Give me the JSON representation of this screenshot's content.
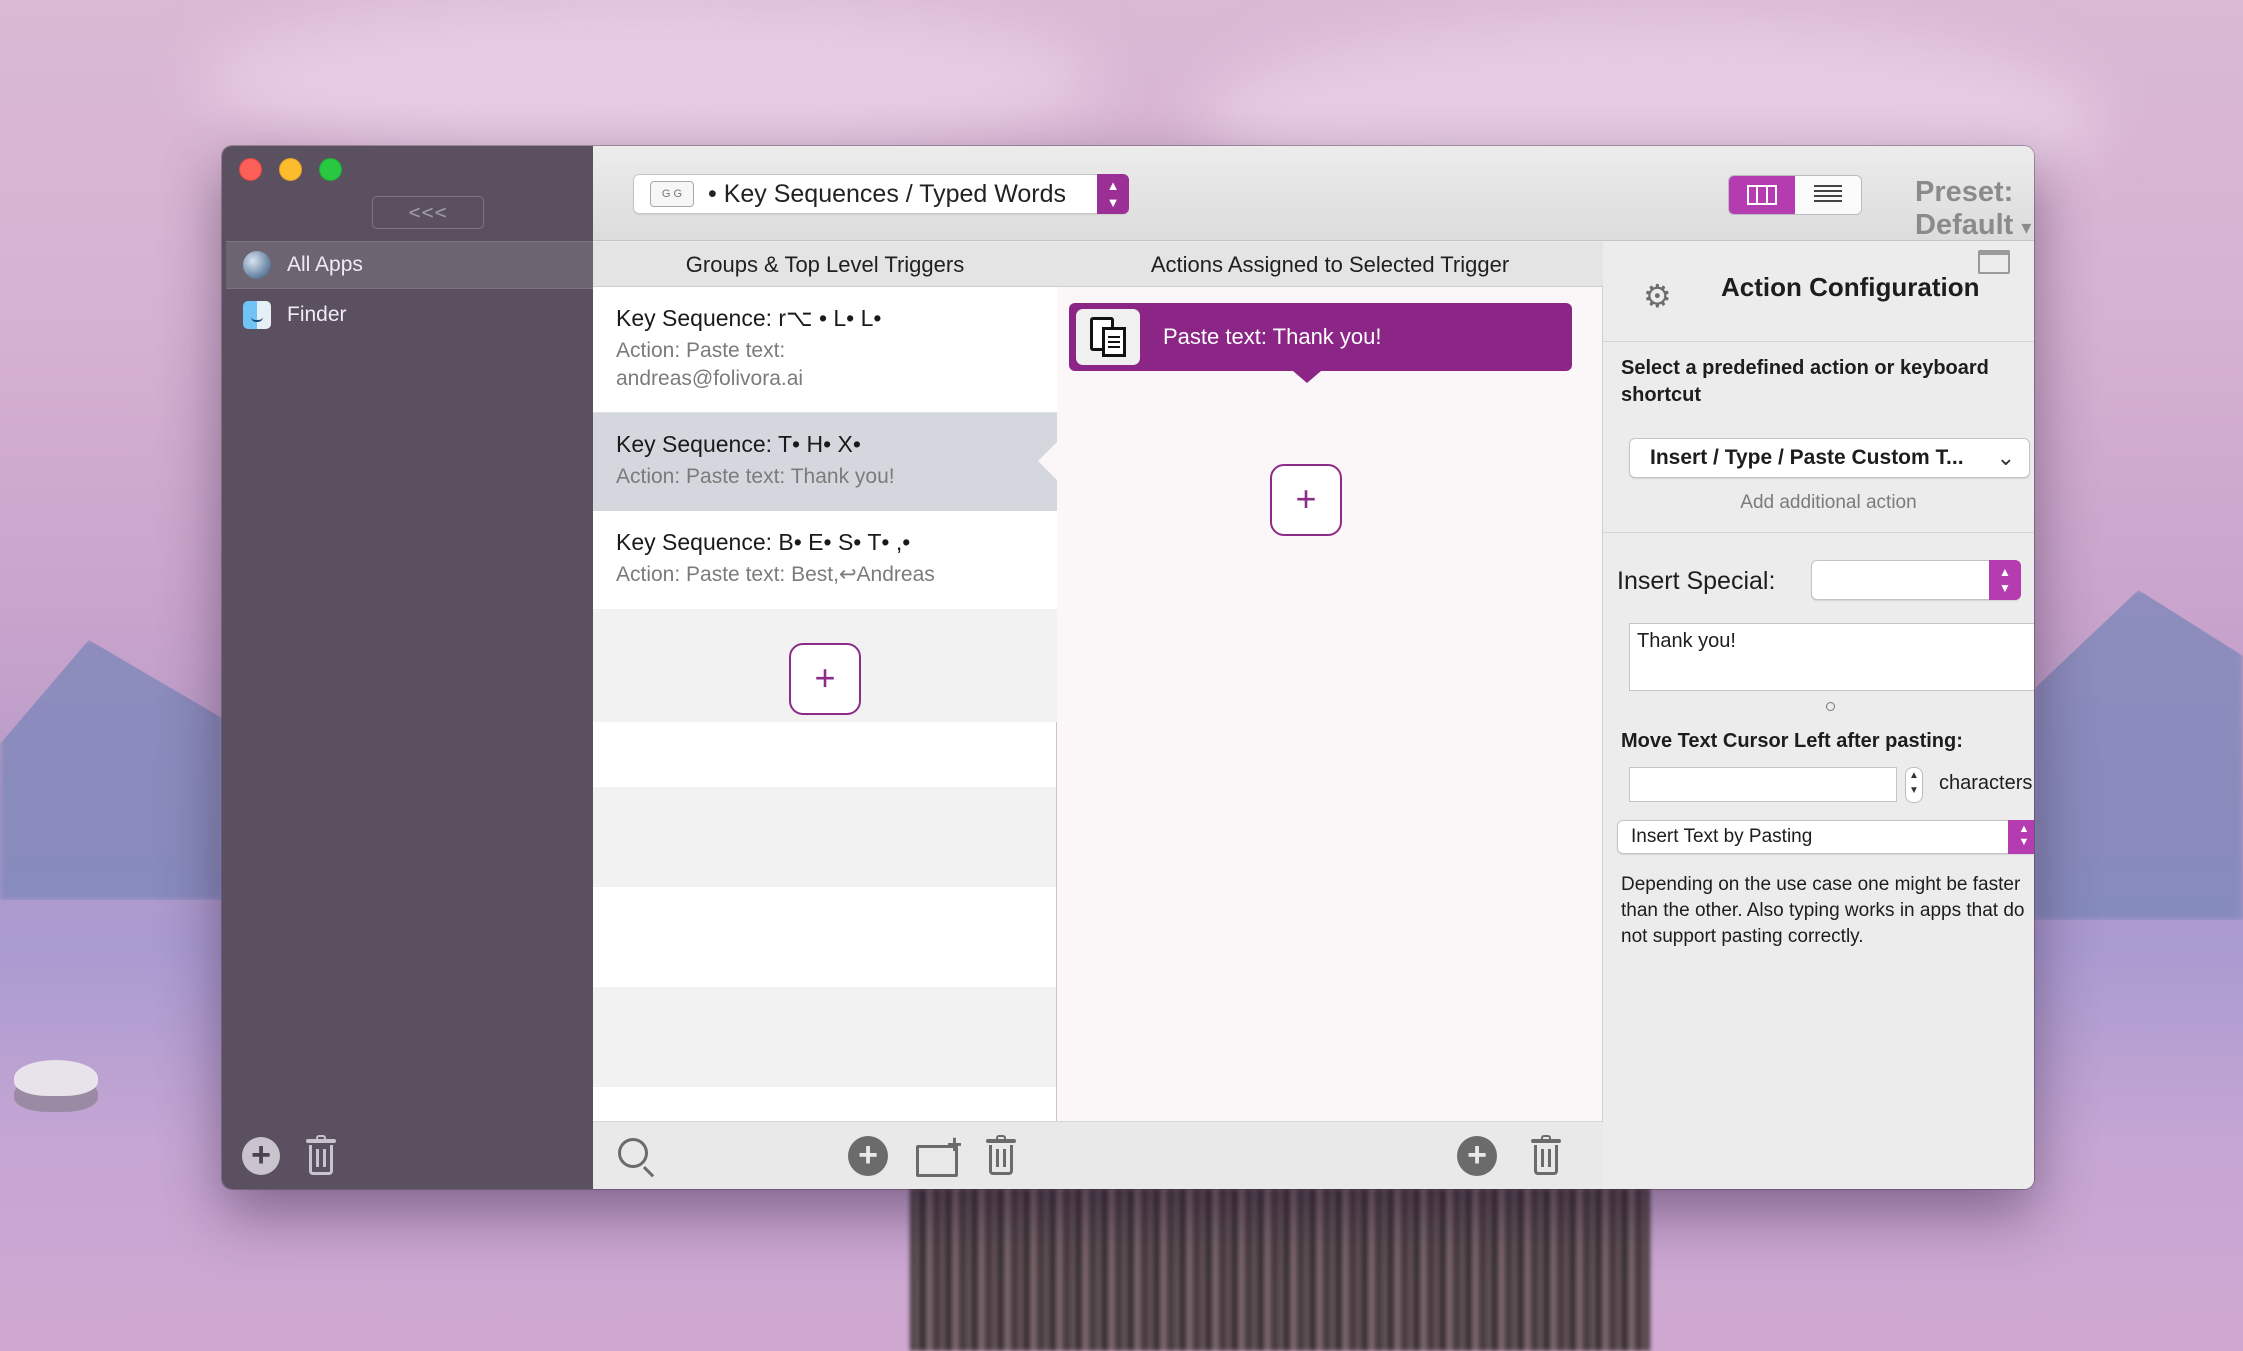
{
  "sidebar": {
    "collapse_label": "<<<",
    "apps": [
      {
        "label": "All Apps",
        "icon": "globe-icon",
        "selected": true
      },
      {
        "label": "Finder",
        "icon": "finder-icon",
        "selected": false
      }
    ]
  },
  "toolbar": {
    "trigger_type": "• Key Sequences / Typed Words",
    "trigger_icon_text": "G G",
    "preset_label": "Preset: Default",
    "preset_arrow": "▾"
  },
  "triggers": {
    "header": "Groups & Top Level Triggers",
    "items": [
      {
        "title": "Key Sequence: r⌥ • L• L•",
        "action": "Action: Paste text: andreas@folivora.ai",
        "selected": false
      },
      {
        "title": "Key Sequence:  T• H• X•",
        "action": "Action: Paste text: Thank you!",
        "selected": true
      },
      {
        "title": "Key Sequence:  B• E• S• T• ,•",
        "action": "Action: Paste text: Best,↩Andreas",
        "selected": false
      }
    ],
    "add_symbol": "+"
  },
  "actions": {
    "header": "Actions Assigned to Selected Trigger",
    "items": [
      {
        "label": "Paste text: Thank you!"
      }
    ],
    "add_symbol": "+"
  },
  "config": {
    "title": "Action Configuration",
    "select_label": "Select a predefined action or keyboard shortcut",
    "action_dropdown": "Insert / Type / Paste Custom T...",
    "dropdown_chevron": "⌄",
    "add_additional": "Add additional action",
    "insert_special_label": "Insert Special:",
    "insert_special_value": "",
    "text_value": "Thank you!",
    "move_cursor_label": "Move Text Cursor Left after pasting:",
    "cursor_value": "",
    "characters_label": "characters",
    "insert_mode": "Insert Text by Pasting",
    "help_text": "Depending on the use case one might be faster than the other. Also typing works in apps that do not support pasting correctly."
  },
  "colors": {
    "accent": "#8b2687",
    "accent_light": "#b43bb0",
    "sidebar": "#5a5060"
  }
}
